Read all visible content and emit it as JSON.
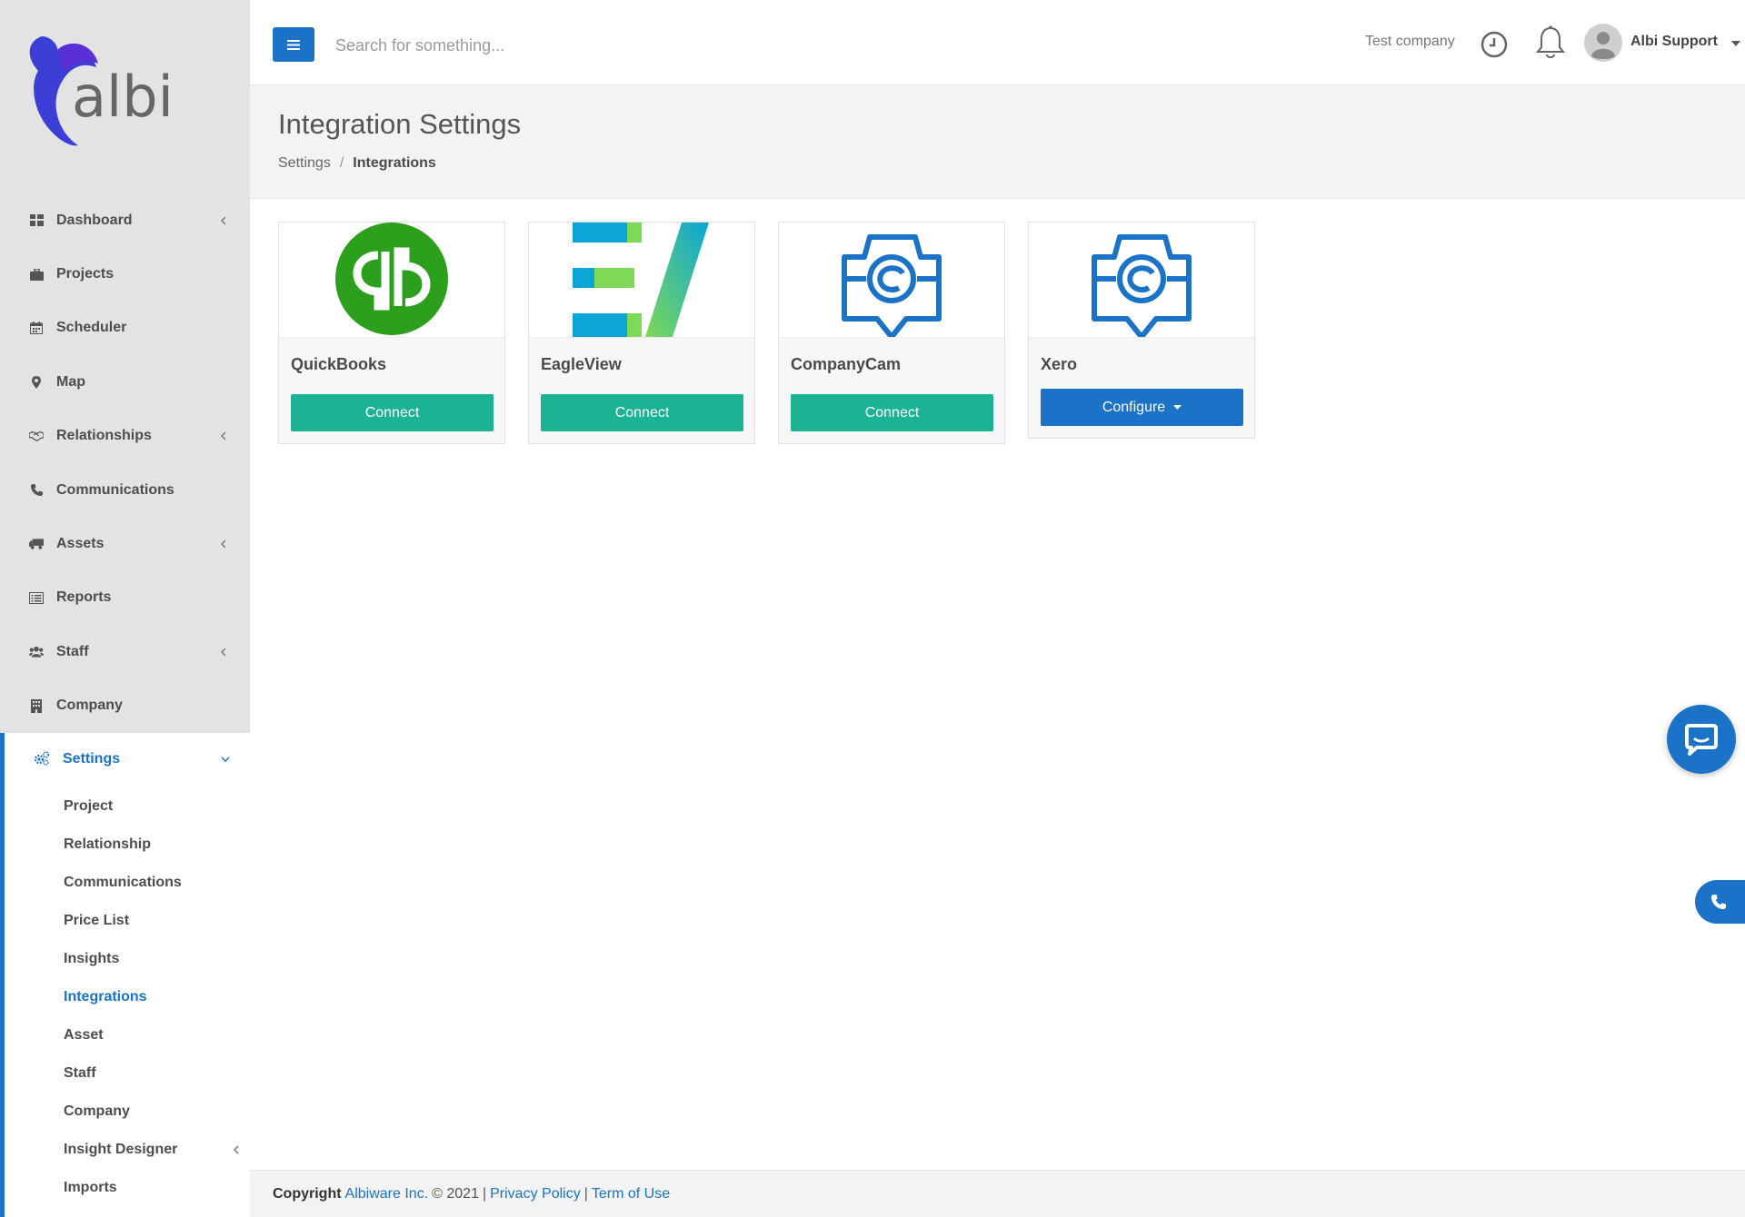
{
  "brand": {
    "logo_text": "albi"
  },
  "sidebar": {
    "items": [
      {
        "label": "Dashboard",
        "icon": "dashboard-icon",
        "expandable": true
      },
      {
        "label": "Projects",
        "icon": "briefcase-icon",
        "expandable": false
      },
      {
        "label": "Scheduler",
        "icon": "calendar-icon",
        "expandable": false
      },
      {
        "label": "Map",
        "icon": "map-pin-icon",
        "expandable": false
      },
      {
        "label": "Relationships",
        "icon": "handshake-icon",
        "expandable": true
      },
      {
        "label": "Communications",
        "icon": "phone-icon",
        "expandable": false
      },
      {
        "label": "Assets",
        "icon": "truck-icon",
        "expandable": true
      },
      {
        "label": "Reports",
        "icon": "list-icon",
        "expandable": false
      },
      {
        "label": "Staff",
        "icon": "users-icon",
        "expandable": true
      },
      {
        "label": "Company",
        "icon": "building-icon",
        "expandable": false
      }
    ],
    "settings": {
      "label": "Settings",
      "icon": "cogs-icon",
      "sub_items": [
        {
          "label": "Project"
        },
        {
          "label": "Relationship"
        },
        {
          "label": "Communications"
        },
        {
          "label": "Price List"
        },
        {
          "label": "Insights"
        },
        {
          "label": "Integrations",
          "active": true
        },
        {
          "label": "Asset"
        },
        {
          "label": "Staff"
        },
        {
          "label": "Company"
        },
        {
          "label": "Insight Designer",
          "expandable": true
        },
        {
          "label": "Imports"
        }
      ]
    }
  },
  "topbar": {
    "search_placeholder": "Search for something...",
    "company": "Test company",
    "user": "Albi Support"
  },
  "page": {
    "title": "Integration Settings",
    "breadcrumb": {
      "parent": "Settings",
      "separator": "/",
      "current": "Integrations"
    }
  },
  "integrations": [
    {
      "name": "QuickBooks",
      "button": "Connect",
      "logo": "quickbooks-logo"
    },
    {
      "name": "EagleView",
      "button": "Connect",
      "logo": "eagleview-logo"
    },
    {
      "name": "CompanyCam",
      "button": "Connect",
      "logo": "companycam-logo"
    },
    {
      "name": "Xero",
      "button": "Configure",
      "logo": "companycam-logo"
    }
  ],
  "footer": {
    "copyright_label": "Copyright",
    "company_link": "Albiware Inc.",
    "year": "© 2021",
    "sep1": "|",
    "privacy": "Privacy Policy",
    "sep2": "|",
    "terms": "Term of Use"
  },
  "colors": {
    "accent": "#1a73c7",
    "connect": "#1cb394",
    "sidebar_bg": "#e3e3e3"
  }
}
